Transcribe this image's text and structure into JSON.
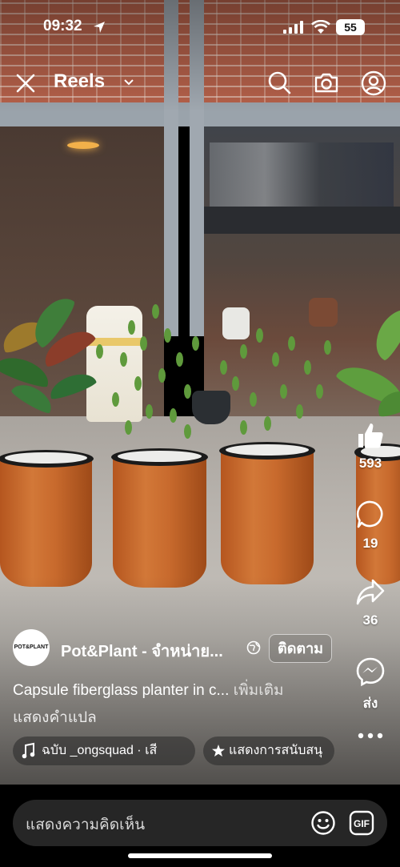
{
  "status_bar": {
    "time": "09:32",
    "battery": "55"
  },
  "header": {
    "title": "Reels"
  },
  "actions": {
    "likes": "593",
    "comments": "19",
    "shares": "36",
    "send_label": "ส่ง"
  },
  "post": {
    "avatar_text": "POT&PLANT",
    "author": "Pot&Plant - จำหน่าย...",
    "follow_label": "ติดตาม",
    "caption": "Capsule fiberglass planter in c...",
    "more_label": "เพิ่มเติม",
    "translate_label": "แสดงคำแปล",
    "music": "ฉบับ    _ongsquad · เสี",
    "support": "แสดงการสนับสนุ"
  },
  "comment_bar": {
    "placeholder": "แสดงความคิดเห็น",
    "gif_label": "GIF"
  }
}
